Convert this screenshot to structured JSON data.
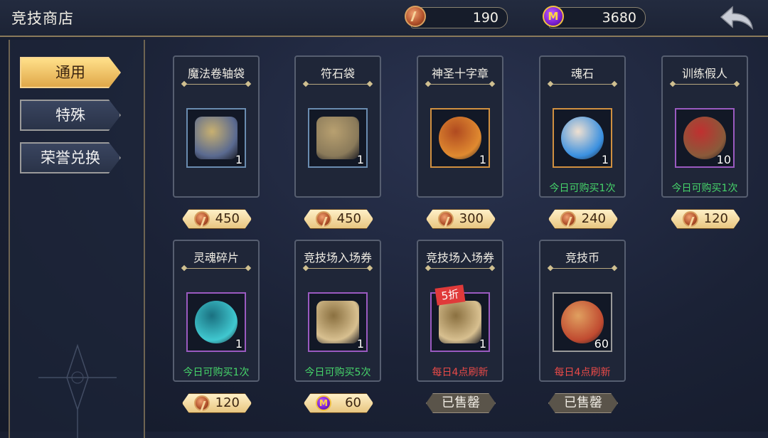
{
  "header": {
    "title": "竞技商店",
    "currency_coin": "190",
    "currency_m": "3680"
  },
  "nav": [
    {
      "label": "通用",
      "active": true
    },
    {
      "label": "特殊",
      "active": false
    },
    {
      "label": "荣誉兑换",
      "active": false
    }
  ],
  "items": [
    {
      "name": "魔法卷轴袋",
      "qty": "1",
      "frame": "blue",
      "icon": "scroll-bag-icon",
      "note": "",
      "price": "450",
      "currency": "coin",
      "sold": false
    },
    {
      "name": "符石袋",
      "qty": "1",
      "frame": "blue",
      "icon": "rune-bag-icon",
      "note": "",
      "price": "450",
      "currency": "coin",
      "sold": false
    },
    {
      "name": "神圣十字章",
      "qty": "1",
      "frame": "orange",
      "icon": "holy-cross-icon",
      "note": "",
      "price": "300",
      "currency": "coin",
      "sold": false
    },
    {
      "name": "魂石",
      "qty": "1",
      "frame": "orange",
      "icon": "soul-stone-icon",
      "note": "今日可购买1次",
      "note_color": "green",
      "price": "240",
      "currency": "coin",
      "sold": false
    },
    {
      "name": "训练假人",
      "qty": "10",
      "frame": "purple",
      "icon": "training-dummy-icon",
      "note": "今日可购买1次",
      "note_color": "green",
      "price": "120",
      "currency": "coin",
      "sold": false
    },
    {
      "name": "灵魂碎片",
      "qty": "1",
      "frame": "purple",
      "icon": "soul-shard-icon",
      "note": "今日可购买1次",
      "note_color": "green",
      "price": "120",
      "currency": "coin",
      "sold": false
    },
    {
      "name": "竞技场入场券",
      "qty": "1",
      "frame": "purple",
      "icon": "arena-ticket-icon",
      "note": "今日可购买5次",
      "note_color": "green",
      "price": "60",
      "currency": "m",
      "sold": false
    },
    {
      "name": "竞技场入场券",
      "qty": "1",
      "frame": "purple",
      "icon": "arena-ticket-icon",
      "badge": "5折",
      "note": "每日4点刷新",
      "note_color": "red",
      "sold": true,
      "sold_label": "已售罄"
    },
    {
      "name": "竞技币",
      "qty": "60",
      "frame": "gray",
      "icon": "arena-coin-icon",
      "note": "每日4点刷新",
      "note_color": "red",
      "sold": true,
      "sold_label": "已售罄"
    }
  ]
}
